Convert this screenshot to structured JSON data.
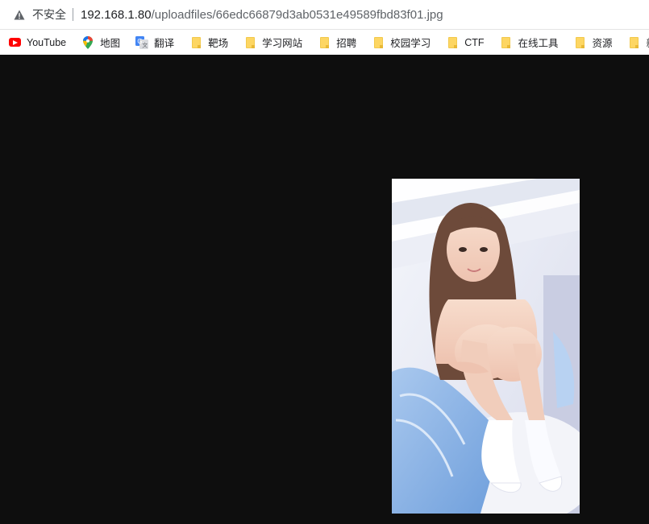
{
  "address_bar": {
    "security_label": "不安全",
    "url_host": "192.168.1.80",
    "url_path": "/uploadfiles/66edc66879d3ab0531e49589fbd83f01.jpg"
  },
  "bookmarks": [
    {
      "label": "YouTube",
      "icon": "youtube-icon"
    },
    {
      "label": "地图",
      "icon": "maps-pin-icon"
    },
    {
      "label": "翻译",
      "icon": "translate-icon"
    },
    {
      "label": "靶场",
      "icon": "folder-icon"
    },
    {
      "label": "学习网站",
      "icon": "folder-icon"
    },
    {
      "label": "招聘",
      "icon": "folder-icon"
    },
    {
      "label": "校园学习",
      "icon": "folder-icon"
    },
    {
      "label": "CTF",
      "icon": "folder-icon"
    },
    {
      "label": "在线工具",
      "icon": "folder-icon"
    },
    {
      "label": "资源",
      "icon": "folder-icon"
    },
    {
      "label": "新潮",
      "icon": "folder-icon"
    }
  ],
  "viewer": {
    "background": "#0e0e0e",
    "image_subject": "photo of a young woman sitting on a bed hugging her knees, wearing white socks, light blue blanket"
  },
  "colors": {
    "folder": "#fdd663",
    "youtube": "#ff0000",
    "toolbar": "#ffffff"
  }
}
